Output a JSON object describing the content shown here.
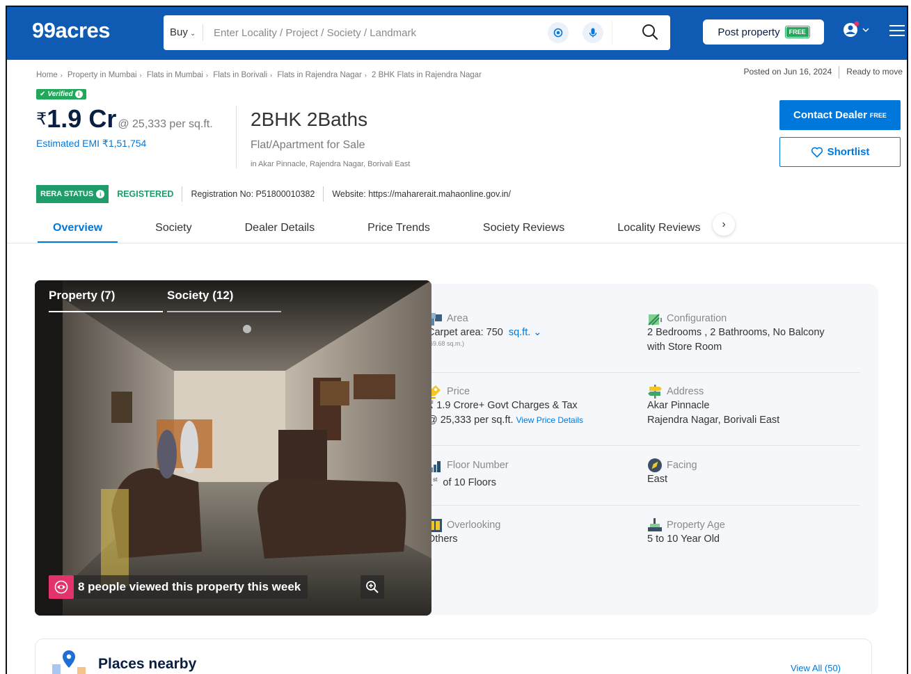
{
  "header": {
    "logo": "99acres",
    "buy_label": "Buy",
    "search_placeholder": "Enter Locality / Project / Society / Landmark",
    "post_property_label": "Post property",
    "post_property_badge": "FREE"
  },
  "breadcrumbs": [
    "Home",
    "Property in Mumbai",
    "Flats in Mumbai",
    "Flats in Borivali",
    "Flats in Rajendra Nagar",
    "2 BHK Flats in Rajendra Nagar"
  ],
  "posted_on": "Posted on Jun 16, 2024",
  "ready_status": "Ready to move",
  "verified_label": "Verified",
  "price": {
    "currency": "₹",
    "amount": "1.9 Cr",
    "per_sqft": "@ 25,333 per sq.ft.",
    "emi": "Estimated EMI ₹1,51,754"
  },
  "title": {
    "main": "2BHK 2Baths",
    "sub": "Flat/Apartment for Sale",
    "location": "in Akar Pinnacle, Rajendra Nagar, Borivali East"
  },
  "actions": {
    "contact_label": "Contact Dealer",
    "contact_badge": "FREE",
    "shortlist_label": "Shortlist"
  },
  "rera": {
    "status_label": "RERA STATUS",
    "status_value": "REGISTERED",
    "registration": "Registration No: P51800010382",
    "website": "Website: https://maharerait.mahaonline.gov.in/"
  },
  "tabs": [
    "Overview",
    "Society",
    "Dealer Details",
    "Price Trends",
    "Society Reviews",
    "Locality Reviews"
  ],
  "gallery": {
    "tab_property": "Property (7)",
    "tab_society": "Society (12)",
    "viewed_text": "8 people viewed this property this week"
  },
  "details": {
    "area": {
      "label": "Area",
      "value": "Carpet area: 750",
      "unit": "sq.ft.",
      "sub": "(69.68 sq.m.)"
    },
    "configuration": {
      "label": "Configuration",
      "line1": "2 Bedrooms , 2 Bathrooms, No Balcony",
      "line2": "with Store Room"
    },
    "price": {
      "label": "Price",
      "line1": "₹ 1.9 Crore+ Govt Charges & Tax",
      "line2": "@ 25,333 per sq.ft.",
      "link": "View Price Details"
    },
    "address": {
      "label": "Address",
      "line1": "Akar Pinnacle",
      "line2": "Rajendra Nagar, Borivali East"
    },
    "floor": {
      "label": "Floor Number",
      "value": "1",
      "sup": "st",
      "rest": "of 10 Floors"
    },
    "facing": {
      "label": "Facing",
      "value": "East"
    },
    "overlooking": {
      "label": "Overlooking",
      "value": "Others"
    },
    "age": {
      "label": "Property Age",
      "value": "5 to 10 Year Old"
    }
  },
  "places": {
    "title": "Places nearby",
    "view_all": "View All (50)"
  },
  "colors": {
    "brand_blue": "#0f5ab3",
    "link_blue": "#0078db",
    "green": "#22a85a",
    "pink": "#e2336b"
  }
}
